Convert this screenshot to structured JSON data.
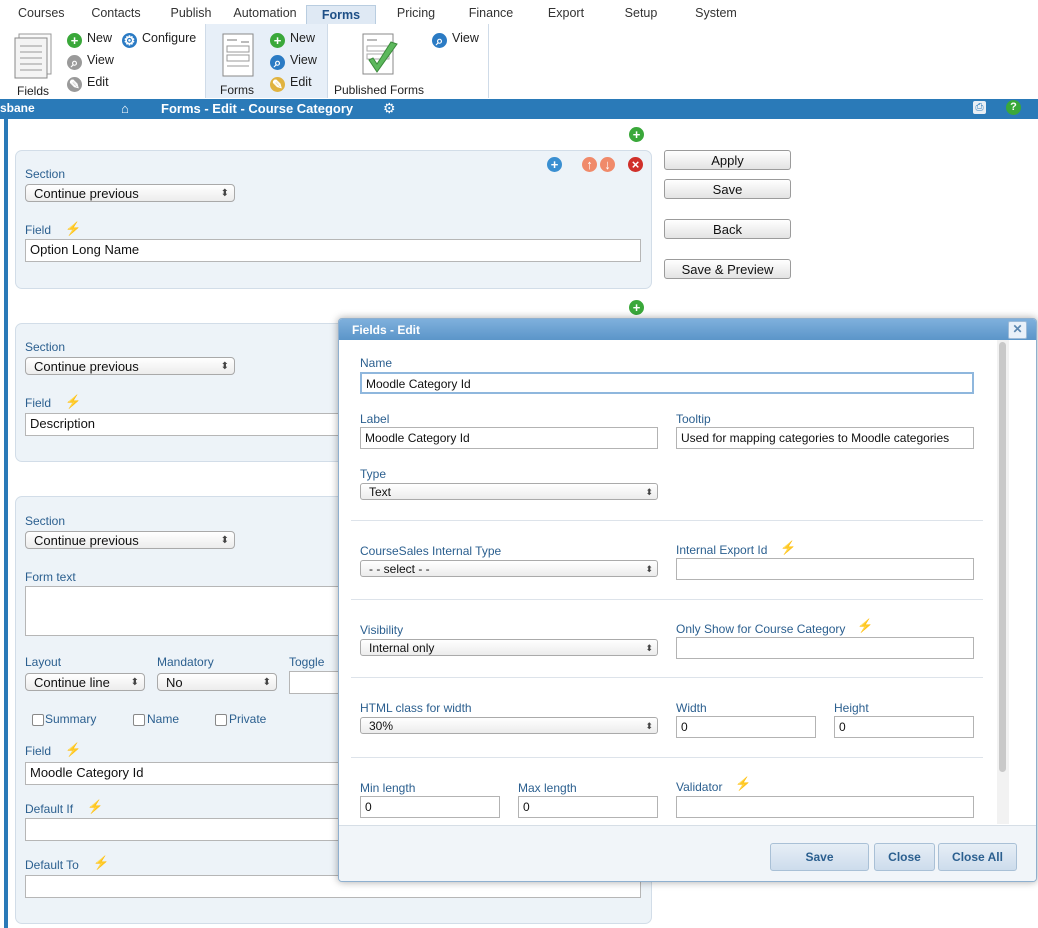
{
  "tabs": [
    {
      "label": "Courses",
      "active": false
    },
    {
      "label": "Contacts",
      "active": false
    },
    {
      "label": "Publish",
      "active": false
    },
    {
      "label": "Automation",
      "active": false
    },
    {
      "label": "Forms",
      "active": true
    },
    {
      "label": "Pricing",
      "active": false
    },
    {
      "label": "Finance",
      "active": false
    },
    {
      "label": "Export",
      "active": false
    },
    {
      "label": "Setup",
      "active": false
    },
    {
      "label": "System",
      "active": false
    }
  ],
  "ribbon": {
    "fields": {
      "label": "Fields",
      "new": "New",
      "configure": "Configure",
      "view": "View",
      "edit": "Edit"
    },
    "forms": {
      "label": "Forms",
      "new": "New",
      "view": "View",
      "edit": "Edit"
    },
    "published": {
      "label": "Published Forms",
      "view": "View"
    }
  },
  "navbar": {
    "city": "sbane",
    "title": "Forms - Edit - Course Category"
  },
  "panel1": {
    "section_label": "Section",
    "section_value": "Continue previous",
    "field_label": "Field",
    "field_value": "Option Long Name"
  },
  "panel2": {
    "section_label": "Section",
    "section_value": "Continue previous",
    "field_label": "Field",
    "field_value": "Description"
  },
  "panel3": {
    "section_label": "Section",
    "section_value": "Continue previous",
    "form_text_label": "Form text",
    "layout_label": "Layout",
    "layout_value": "Continue line",
    "mandatory_label": "Mandatory",
    "mandatory_value": "No",
    "toggle_label": "Toggle",
    "summary_label": "Summary",
    "name_label": "Name",
    "private_label": "Private",
    "field_label": "Field",
    "field_value": "Moodle Category Id",
    "default_if_label": "Default If",
    "default_to_label": "Default To"
  },
  "actions": {
    "apply": "Apply",
    "save": "Save",
    "back": "Back",
    "save_preview": "Save & Preview"
  },
  "modal": {
    "title": "Fields - Edit",
    "name_label": "Name",
    "name_value": "Moodle Category Id",
    "label_label": "Label",
    "label_value": "Moodle Category Id",
    "tooltip_label": "Tooltip",
    "tooltip_value": "Used for mapping categories to Moodle categories",
    "type_label": "Type",
    "type_value": "Text",
    "internal_type_label": "CourseSales Internal Type",
    "internal_type_value": "- - select - -",
    "export_id_label": "Internal Export Id",
    "export_id_value": "",
    "visibility_label": "Visibility",
    "visibility_value": "Internal only",
    "only_show_label": "Only Show for Course Category",
    "only_show_value": "",
    "html_class_label": "HTML class for width",
    "html_class_value": "30%",
    "width_label": "Width",
    "width_value": "0",
    "height_label": "Height",
    "height_value": "0",
    "min_len_label": "Min length",
    "min_len_value": "0",
    "max_len_label": "Max length",
    "max_len_value": "0",
    "validator_label": "Validator",
    "validator_value": "",
    "save": "Save",
    "close": "Close",
    "close_all": "Close All"
  },
  "colors": {
    "accent": "#2a7ab8",
    "label": "#2b5f8f",
    "panel_bg": "#edf3f8",
    "bolt": "#e3c21b"
  }
}
